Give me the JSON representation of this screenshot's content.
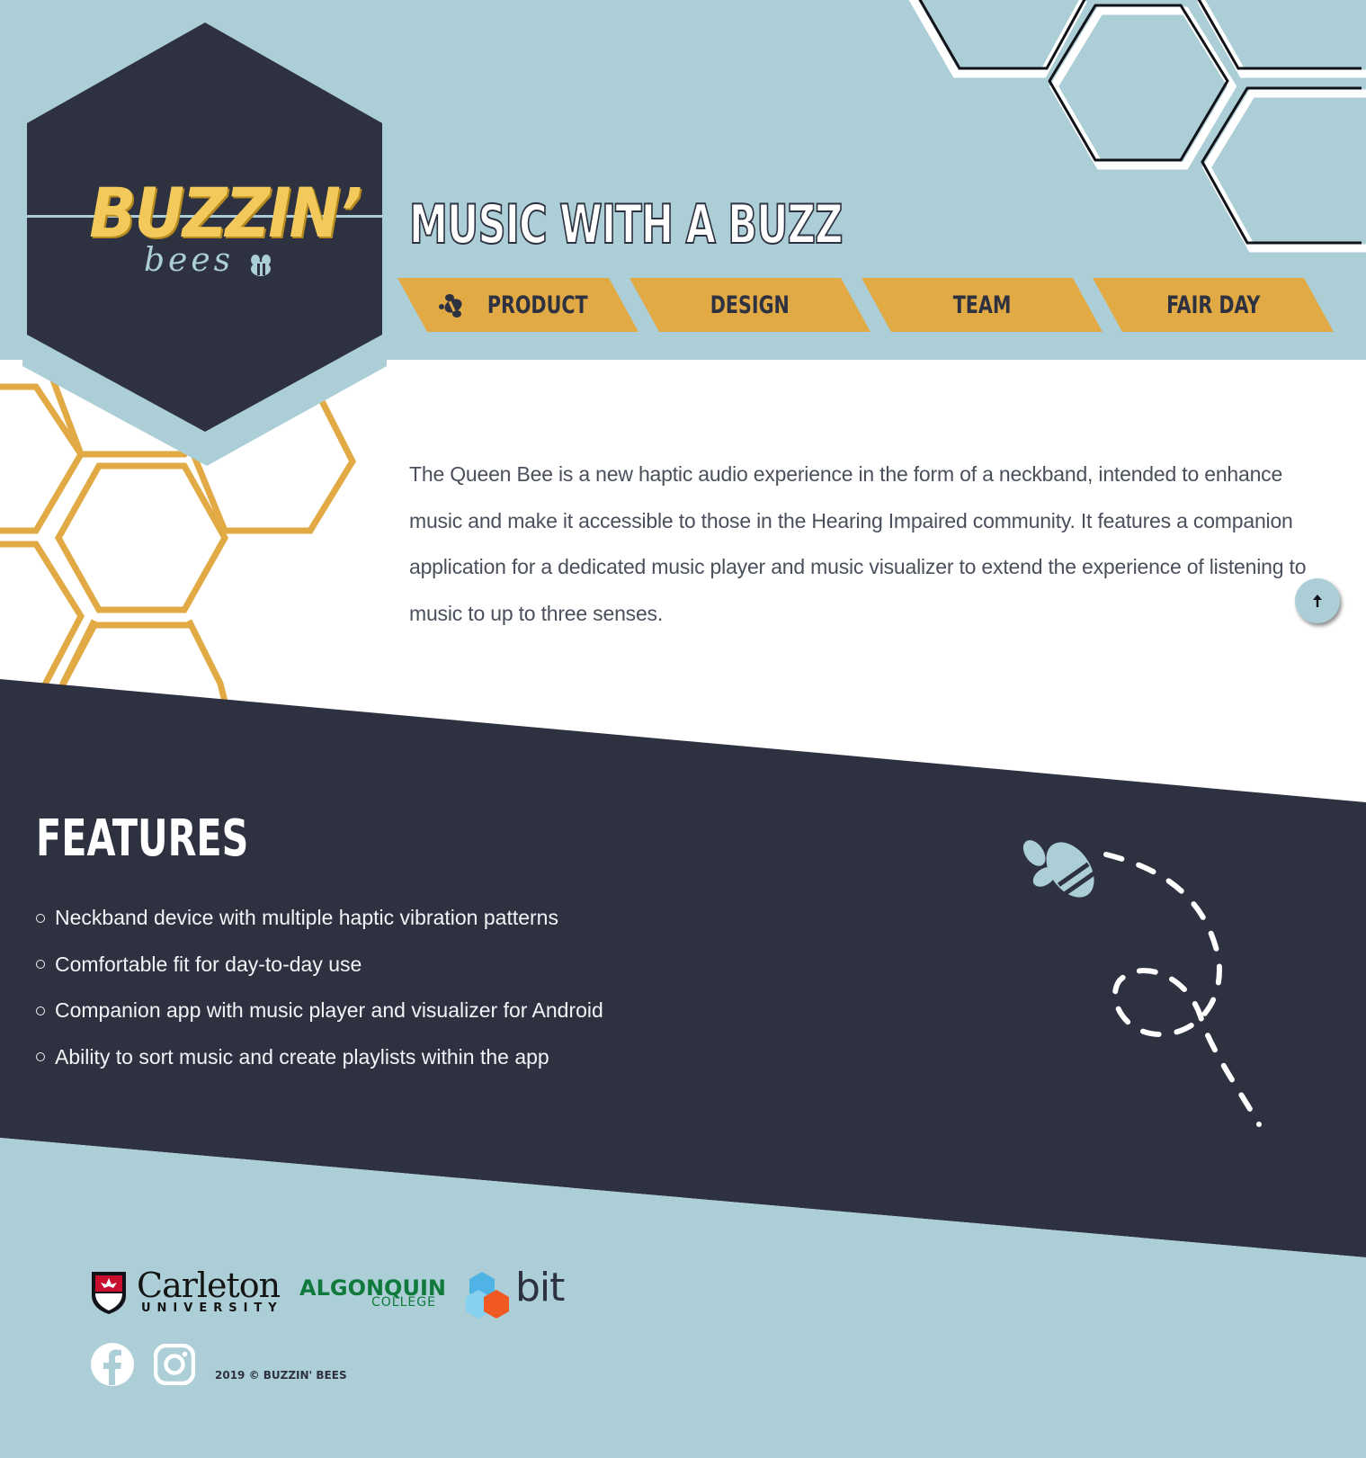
{
  "brand": {
    "title": "BUZZIN’",
    "subtitle": "bees"
  },
  "tagline": "MUSIC WITH A BUZZ",
  "nav": {
    "items": [
      {
        "label": "PRODUCT",
        "icon": "bee-icon"
      },
      {
        "label": "DESIGN"
      },
      {
        "label": "TEAM"
      },
      {
        "label": "FAIR DAY"
      }
    ]
  },
  "intro": "The Queen Bee is a new haptic audio experience in the form of a neckband, intended to enhance music and make it accessible to those in the Hearing Impaired community. It features a companion application for a dedicated music player and music visualizer to extend the experience of listening to music to up to three senses.",
  "back_to_top": {
    "icon": "arrow-up-icon"
  },
  "features": {
    "title": "FEATURES",
    "items": [
      "Neckband device with multiple haptic vibration patterns",
      "Comfortable fit for day-to-day use",
      "Companion app with music player and visualizer for Android",
      "Ability to sort music and create playlists within the app"
    ]
  },
  "footer": {
    "partners": {
      "carleton": {
        "name": "Carleton",
        "sub": "UNIVERSITY"
      },
      "algonquin": {
        "name": "ALGONQUIN",
        "sub": "COLLEGE"
      },
      "bit": {
        "name": "bit"
      }
    },
    "social": [
      "facebook-icon",
      "instagram-icon"
    ],
    "copyright": "2019 © BUZZIN' BEES"
  },
  "colors": {
    "light_blue": "#acced6",
    "dark_navy": "#2e3240",
    "honey": "#e2aa44",
    "gold_text": "#f3c95b",
    "text_gray": "#4a4f5c"
  }
}
